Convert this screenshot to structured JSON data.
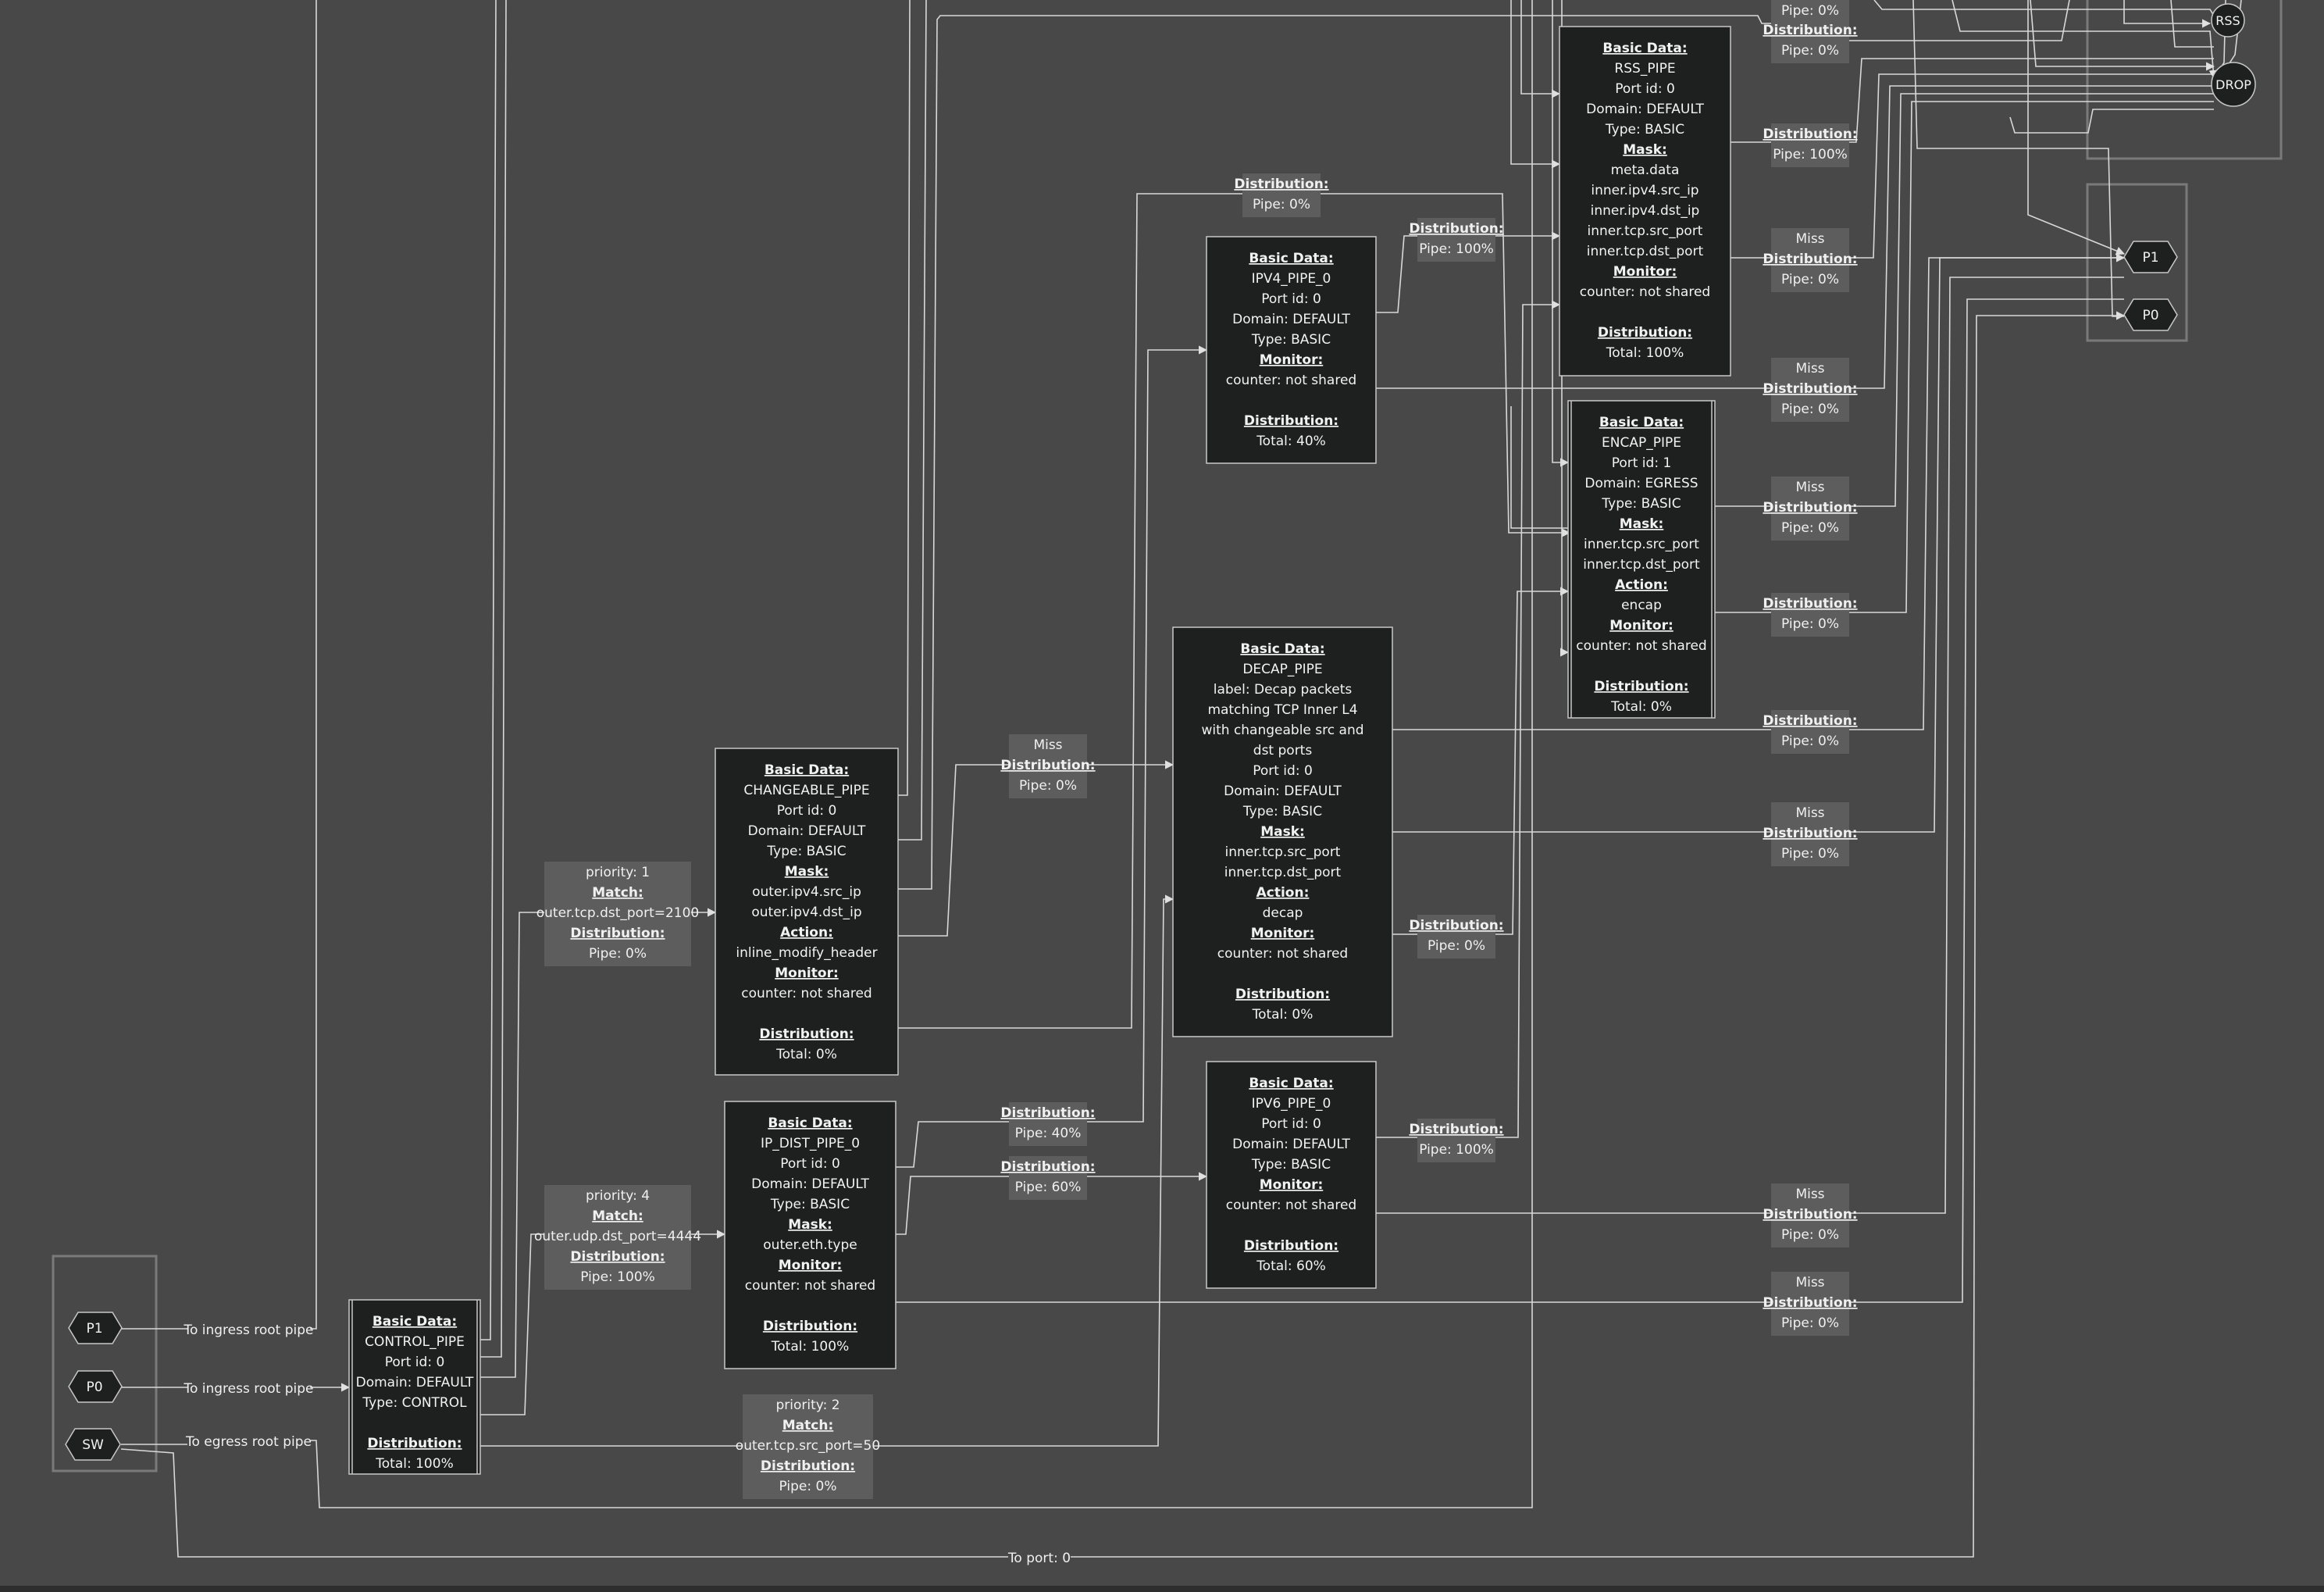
{
  "nodes": {
    "rss_pipe": [
      "Basic Data:",
      "RSS_PIPE",
      "Port id: 0",
      "Domain: DEFAULT",
      "Type: BASIC",
      "Mask:",
      "meta.data",
      "inner.ipv4.src_ip",
      "inner.ipv4.dst_ip",
      "inner.tcp.src_port",
      "inner.tcp.dst_port",
      "Monitor:",
      "counter: not shared",
      "",
      "Distribution:",
      "Total: 100%"
    ],
    "ipv4_pipe": [
      "Basic Data:",
      "IPV4_PIPE_0",
      "Port id: 0",
      "Domain: DEFAULT",
      "Type: BASIC",
      "Monitor:",
      "counter: not shared",
      "",
      "Distribution:",
      "Total: 40%"
    ],
    "encap_pipe": [
      "Basic Data:",
      "ENCAP_PIPE",
      "Port id: 1",
      "Domain: EGRESS",
      "Type: BASIC",
      "Mask:",
      "inner.tcp.src_port",
      "inner.tcp.dst_port",
      "Action:",
      "encap",
      "Monitor:",
      "counter: not shared",
      "",
      "Distribution:",
      "Total: 0%"
    ],
    "decap_pipe": [
      "Basic Data:",
      "DECAP_PIPE",
      "label: Decap packets",
      "matching TCP Inner L4",
      "with changeable src and",
      "dst ports",
      "Port id: 0",
      "Domain: DEFAULT",
      "Type: BASIC",
      "Mask:",
      "inner.tcp.src_port",
      "inner.tcp.dst_port",
      "Action:",
      "decap",
      "Monitor:",
      "counter: not shared",
      "",
      "Distribution:",
      "Total: 0%"
    ],
    "changeable_pipe": [
      "Basic Data:",
      "CHANGEABLE_PIPE",
      "Port id: 0",
      "Domain: DEFAULT",
      "Type: BASIC",
      "Mask:",
      "outer.ipv4.src_ip",
      "outer.ipv4.dst_ip",
      "Action:",
      "inline_modify_header",
      "Monitor:",
      "counter: not shared",
      "",
      "Distribution:",
      "Total: 0%"
    ],
    "ip_dist_pipe": [
      "Basic Data:",
      "IP_DIST_PIPE_0",
      "Port id: 0",
      "Domain: DEFAULT",
      "Type: BASIC",
      "Mask:",
      "outer.eth.type",
      "Monitor:",
      "counter: not shared",
      "",
      "Distribution:",
      "Total: 100%"
    ],
    "ipv6_pipe": [
      "Basic Data:",
      "IPV6_PIPE_0",
      "Port id: 0",
      "Domain: DEFAULT",
      "Type: BASIC",
      "Monitor:",
      "counter: not shared",
      "",
      "Distribution:",
      "Total: 60%"
    ],
    "control_pipe": [
      "Basic Data:",
      "CONTROL_PIPE",
      "Port id: 0",
      "Domain: DEFAULT",
      "Type: CONTROL",
      "",
      "Distribution:",
      "Total: 100%"
    ]
  },
  "labels": {
    "top_cut": [
      "Pipe: 0%"
    ],
    "rss_dist_top": [
      "Distribution:",
      "Pipe: 0%"
    ],
    "rss_to_rss": [
      "Distribution:",
      "Pipe: 100%"
    ],
    "rss_miss": [
      "Miss",
      "Distribution:",
      "Pipe: 0%"
    ],
    "ipv4_top": [
      "Distribution:",
      "Pipe: 0%"
    ],
    "ipv4_to_rss": [
      "Distribution:",
      "Pipe: 100%"
    ],
    "ipv4_miss": [
      "Miss",
      "Distribution:",
      "Pipe: 0%"
    ],
    "encap_miss": [
      "Miss",
      "Distribution:",
      "Pipe: 0%"
    ],
    "encap_dist": [
      "Distribution:",
      "Pipe: 0%"
    ],
    "decap_dist_right": [
      "Distribution:",
      "Pipe: 0%"
    ],
    "decap_miss": [
      "Miss",
      "Distribution:",
      "Pipe: 0%"
    ],
    "decap_to_encap": [
      "Distribution:",
      "Pipe: 0%"
    ],
    "changeable_miss": [
      "Miss",
      "Distribution:",
      "Pipe: 0%"
    ],
    "ipdist_40": [
      "Distribution:",
      "Pipe: 40%"
    ],
    "ipdist_60": [
      "Distribution:",
      "Pipe: 60%"
    ],
    "ipv6_to_rss": [
      "Distribution:",
      "Pipe: 100%"
    ],
    "ipv6_miss": [
      "Miss",
      "Distribution:",
      "Pipe: 0%"
    ],
    "ipdist_miss": [
      "Miss",
      "Distribution:",
      "Pipe: 0%"
    ],
    "prio1": [
      "priority: 1",
      "Match:",
      "outer.tcp.dst_port=2100",
      "Distribution:",
      "Pipe: 0%"
    ],
    "prio4": [
      "priority: 4",
      "Match:",
      "outer.udp.dst_port=4444",
      "Distribution:",
      "Pipe: 100%"
    ],
    "prio2": [
      "priority: 2",
      "Match:",
      "outer.tcp.src_port=50",
      "Distribution:",
      "Pipe: 0%"
    ],
    "to_ingress_1": [
      "To ingress root pipe"
    ],
    "to_ingress_0": [
      "To ingress root pipe"
    ],
    "to_egress": [
      "To egress root pipe"
    ],
    "to_port_0": [
      "To port: 0"
    ]
  },
  "ports": {
    "src_p1": "P1",
    "src_p0": "P0",
    "src_sw": "SW",
    "dst_p1": "P1",
    "dst_p0": "P0",
    "rss": "RSS",
    "drop": "DROP"
  },
  "colors": {
    "background": "#484848",
    "node_fill": "#1e1f1f",
    "node_stroke": "#c8c8c8",
    "label_fill": "#5d5d5d",
    "edge": "#d8d8d8",
    "group_stroke": "#7a7a7a"
  }
}
